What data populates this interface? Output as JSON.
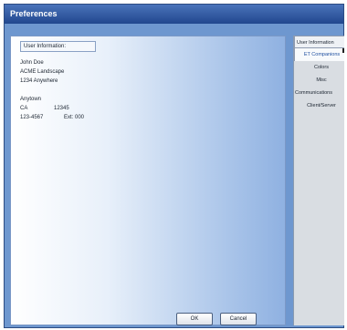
{
  "window": {
    "title": "Preferences"
  },
  "panel": {
    "section_label": "User Information:",
    "name": "John Doe",
    "company": "ACME Landscape",
    "address": "1234 Anywhere",
    "city": "Anytown",
    "state": "CA",
    "zip": "12345",
    "phone": "123-4567",
    "ext": "Ext: 000"
  },
  "buttons": {
    "ok": "OK",
    "cancel": "Cancel"
  },
  "tabs": [
    {
      "label": "User Information"
    },
    {
      "label": "ET Companions"
    },
    {
      "label": "Colors"
    },
    {
      "label": "Misc"
    },
    {
      "label": "Communications"
    },
    {
      "label": "Client/Server"
    }
  ]
}
